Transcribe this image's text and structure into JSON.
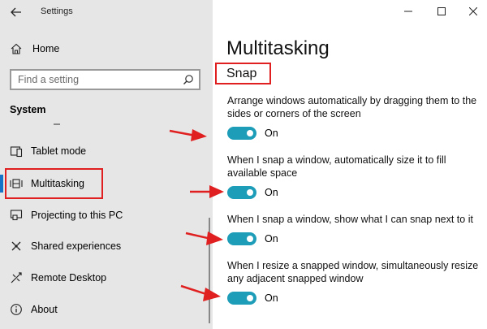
{
  "window": {
    "title": "Settings",
    "controls": [
      "minimize",
      "maximize",
      "close"
    ]
  },
  "sidebar": {
    "home_label": "Home",
    "search_placeholder": "Find a setting",
    "section_title": "System",
    "items": [
      {
        "label": "Tablet mode",
        "icon": "tablet-mode-icon"
      },
      {
        "label": "Multitasking",
        "icon": "multitasking-icon",
        "active": true
      },
      {
        "label": "Projecting to this PC",
        "icon": "projecting-icon"
      },
      {
        "label": "Shared experiences",
        "icon": "shared-experiences-icon"
      },
      {
        "label": "Remote Desktop",
        "icon": "remote-desktop-icon"
      },
      {
        "label": "About",
        "icon": "info-icon"
      }
    ]
  },
  "main": {
    "page_title": "Multitasking",
    "section_heading": "Snap",
    "settings": [
      {
        "description": "Arrange windows automatically by dragging them to the sides or corners of the screen",
        "state": "On"
      },
      {
        "description": "When I snap a window, automatically size it to fill available space",
        "state": "On"
      },
      {
        "description": "When I snap a window, show what I can snap next to it",
        "state": "On"
      },
      {
        "description": "When I resize a snapped window, simultaneously resize any adjacent snapped window",
        "state": "On"
      }
    ]
  },
  "colors": {
    "toggle_on": "#1d9db8",
    "annotation": "#e02020",
    "accent": "#1673c7",
    "sidebar_bg": "#e6e6e6"
  }
}
